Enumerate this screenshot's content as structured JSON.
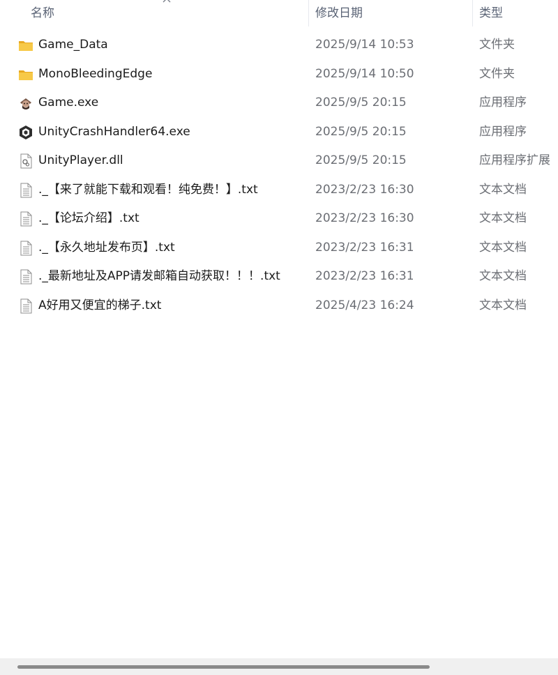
{
  "columns": {
    "name": "名称",
    "date": "修改日期",
    "type": "类型"
  },
  "files": [
    {
      "name": "Game_Data",
      "date": "2025/9/14 10:53",
      "type": "文件夹",
      "icon": "folder-icon"
    },
    {
      "name": "MonoBleedingEdge",
      "date": "2025/9/14 10:50",
      "type": "文件夹",
      "icon": "folder-icon"
    },
    {
      "name": "Game.exe",
      "date": "2025/9/5 20:15",
      "type": "应用程序",
      "icon": "game-app-icon"
    },
    {
      "name": "UnityCrashHandler64.exe",
      "date": "2025/9/5 20:15",
      "type": "应用程序",
      "icon": "unity-app-icon"
    },
    {
      "name": "UnityPlayer.dll",
      "date": "2025/9/5 20:15",
      "type": "应用程序扩展",
      "icon": "dll-file-icon"
    },
    {
      "name": "._【来了就能下载和观看！纯免费！】.txt",
      "date": "2023/2/23 16:30",
      "type": "文本文档",
      "icon": "text-file-icon"
    },
    {
      "name": "._【论坛介绍】.txt",
      "date": "2023/2/23 16:30",
      "type": "文本文档",
      "icon": "text-file-icon"
    },
    {
      "name": "._【永久地址发布页】.txt",
      "date": "2023/2/23 16:31",
      "type": "文本文档",
      "icon": "text-file-icon"
    },
    {
      "name": "._最新地址及APP请发邮箱自动获取！！！.txt",
      "date": "2023/2/23 16:31",
      "type": "文本文档",
      "icon": "text-file-icon"
    },
    {
      "name": "A好用又便宜的梯子.txt",
      "date": "2025/4/23 16:24",
      "type": "文本文档",
      "icon": "text-file-icon"
    }
  ],
  "colors": {
    "folder": "#f5c242",
    "header_text": "#5a6375",
    "secondary_text": "#6b6e74"
  },
  "scrollbar": {
    "horizontal_visible_fraction": 0.74
  }
}
